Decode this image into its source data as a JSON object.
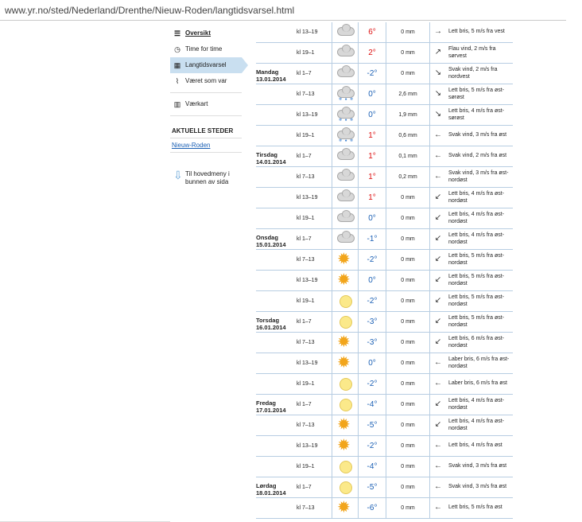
{
  "browser": {
    "url": "www.yr.no/sted/Nederland/Drenthe/Nieuw-Roden/langtidsvarsel.html"
  },
  "sidebar": {
    "items": [
      {
        "label": "Oversikt",
        "icon": "list-icon"
      },
      {
        "label": "Time for time",
        "icon": "clock-icon"
      },
      {
        "label": "Langtidsvarsel",
        "icon": "calendar-icon"
      },
      {
        "label": "Været som var",
        "icon": "graph-icon"
      },
      {
        "label": "Værkart",
        "icon": "map-icon"
      }
    ],
    "section_title": "AKTUELLE STEDER",
    "location_link": "Nieuw-Roden",
    "back_menu": "Til hovedmeny i bunnen av sida"
  },
  "forecast": {
    "rows": [
      {
        "day": "",
        "date": "",
        "period": "kl 13–19",
        "symbol": "cloud",
        "temp": "6°",
        "temp_class": "warm",
        "precip": "0 mm",
        "wind_arrow": "→",
        "wind": "Lett bris, 5 m/s fra vest"
      },
      {
        "day": "",
        "date": "",
        "period": "kl 19–1",
        "symbol": "cloud",
        "temp": "2°",
        "temp_class": "warm",
        "precip": "0 mm",
        "wind_arrow": "↗",
        "wind": "Flau vind, 2 m/s fra sørvest"
      },
      {
        "day": "Mandag",
        "date": "13.01.2014",
        "period": "kl 1–7",
        "symbol": "cloud",
        "temp": "-2°",
        "temp_class": "cold",
        "precip": "0 mm",
        "wind_arrow": "↘",
        "wind": "Svak vind, 2 m/s fra nordvest"
      },
      {
        "day": "",
        "date": "",
        "period": "kl 7–13",
        "symbol": "sleet",
        "temp": "0°",
        "temp_class": "cold",
        "precip": "2,6 mm",
        "wind_arrow": "↘",
        "wind": "Lett bris, 5 m/s fra øst-sørøst"
      },
      {
        "day": "",
        "date": "",
        "period": "kl 13–19",
        "symbol": "sleet",
        "temp": "0°",
        "temp_class": "cold",
        "precip": "1,9 mm",
        "wind_arrow": "↘",
        "wind": "Lett bris, 4 m/s fra øst-sørøst"
      },
      {
        "day": "",
        "date": "",
        "period": "kl 19–1",
        "symbol": "sleet",
        "temp": "1°",
        "temp_class": "warm",
        "precip": "0,6 mm",
        "wind_arrow": "←",
        "wind": "Svak vind, 3 m/s fra øst"
      },
      {
        "day": "Tirsdag",
        "date": "14.01.2014",
        "period": "kl 1–7",
        "symbol": "cloud",
        "temp": "1°",
        "temp_class": "warm",
        "precip": "0,1 mm",
        "wind_arrow": "←",
        "wind": "Svak vind, 2 m/s fra øst"
      },
      {
        "day": "",
        "date": "",
        "period": "kl 7–13",
        "symbol": "cloud",
        "temp": "1°",
        "temp_class": "warm",
        "precip": "0,2 mm",
        "wind_arrow": "←",
        "wind": "Svak vind, 3 m/s fra øst-nordøst"
      },
      {
        "day": "",
        "date": "",
        "period": "kl 13–19",
        "symbol": "cloud",
        "temp": "1°",
        "temp_class": "warm",
        "precip": "0 mm",
        "wind_arrow": "↙",
        "wind": "Lett bris, 4 m/s fra øst-nordøst"
      },
      {
        "day": "",
        "date": "",
        "period": "kl 19–1",
        "symbol": "cloud",
        "temp": "0°",
        "temp_class": "cold",
        "precip": "0 mm",
        "wind_arrow": "↙",
        "wind": "Lett bris, 4 m/s fra øst-nordøst"
      },
      {
        "day": "Onsdag",
        "date": "15.01.2014",
        "period": "kl 1–7",
        "symbol": "cloud",
        "temp": "-1°",
        "temp_class": "cold",
        "precip": "0 mm",
        "wind_arrow": "↙",
        "wind": "Lett bris, 4 m/s fra øst-nordøst"
      },
      {
        "day": "",
        "date": "",
        "period": "kl 7–13",
        "symbol": "sun",
        "temp": "-2°",
        "temp_class": "cold",
        "precip": "0 mm",
        "wind_arrow": "↙",
        "wind": "Lett bris, 5 m/s fra øst-nordøst"
      },
      {
        "day": "",
        "date": "",
        "period": "kl 13–19",
        "symbol": "sun",
        "temp": "0°",
        "temp_class": "cold",
        "precip": "0 mm",
        "wind_arrow": "↙",
        "wind": "Lett bris, 5 m/s fra øst-nordøst"
      },
      {
        "day": "",
        "date": "",
        "period": "kl 19–1",
        "symbol": "moon",
        "temp": "-2°",
        "temp_class": "cold",
        "precip": "0 mm",
        "wind_arrow": "↙",
        "wind": "Lett bris, 5 m/s fra øst-nordøst"
      },
      {
        "day": "Torsdag",
        "date": "16.01.2014",
        "period": "kl 1–7",
        "symbol": "moon",
        "temp": "-3°",
        "temp_class": "cold",
        "precip": "0 mm",
        "wind_arrow": "↙",
        "wind": "Lett bris, 5 m/s fra øst-nordøst"
      },
      {
        "day": "",
        "date": "",
        "period": "kl 7–13",
        "symbol": "sun",
        "temp": "-3°",
        "temp_class": "cold",
        "precip": "0 mm",
        "wind_arrow": "↙",
        "wind": "Lett bris, 6 m/s fra øst-nordøst"
      },
      {
        "day": "",
        "date": "",
        "period": "kl 13–19",
        "symbol": "sun",
        "temp": "0°",
        "temp_class": "cold",
        "precip": "0 mm",
        "wind_arrow": "←",
        "wind": "Laber bris, 6 m/s fra øst-nordøst"
      },
      {
        "day": "",
        "date": "",
        "period": "kl 19–1",
        "symbol": "moon",
        "temp": "-2°",
        "temp_class": "cold",
        "precip": "0 mm",
        "wind_arrow": "←",
        "wind": "Laber bris, 6 m/s fra øst"
      },
      {
        "day": "Fredag",
        "date": "17.01.2014",
        "period": "kl 1–7",
        "symbol": "moon",
        "temp": "-4°",
        "temp_class": "cold",
        "precip": "0 mm",
        "wind_arrow": "↙",
        "wind": "Lett bris, 4 m/s fra øst-nordøst"
      },
      {
        "day": "",
        "date": "",
        "period": "kl 7–13",
        "symbol": "sun",
        "temp": "-5°",
        "temp_class": "cold",
        "precip": "0 mm",
        "wind_arrow": "↙",
        "wind": "Lett bris, 4 m/s fra øst-nordøst"
      },
      {
        "day": "",
        "date": "",
        "period": "kl 13–19",
        "symbol": "sun",
        "temp": "-2°",
        "temp_class": "cold",
        "precip": "0 mm",
        "wind_arrow": "←",
        "wind": "Lett bris, 4 m/s fra øst"
      },
      {
        "day": "",
        "date": "",
        "period": "kl 19–1",
        "symbol": "moon",
        "temp": "-4°",
        "temp_class": "cold",
        "precip": "0 mm",
        "wind_arrow": "←",
        "wind": "Svak vind, 3 m/s fra øst"
      },
      {
        "day": "Lørdag",
        "date": "18.01.2014",
        "period": "kl 1–7",
        "symbol": "moon",
        "temp": "-5°",
        "temp_class": "cold",
        "precip": "0 mm",
        "wind_arrow": "←",
        "wind": "Svak vind, 3 m/s fra øst"
      },
      {
        "day": "",
        "date": "",
        "period": "kl 7–13",
        "symbol": "sun",
        "temp": "-6°",
        "temp_class": "cold",
        "precip": "0 mm",
        "wind_arrow": "←",
        "wind": "Lett bris, 5 m/s fra øst"
      }
    ]
  }
}
